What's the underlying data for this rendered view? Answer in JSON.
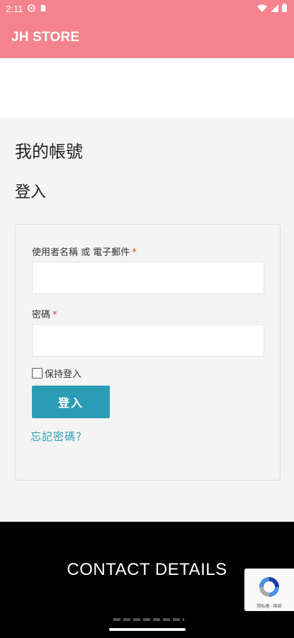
{
  "status_bar": {
    "time": "2:11"
  },
  "app_bar": {
    "title": "JH STORE"
  },
  "account": {
    "page_title": "我的帳號",
    "section_title": "登入"
  },
  "login_form": {
    "username_label": "使用者名稱 或 電子郵件",
    "password_label": "密碼",
    "required_mark": "*",
    "username_value": "",
    "password_value": "",
    "remember_label": "保持登入",
    "remember_checked": false,
    "submit_label": "登入",
    "forgot_link": "忘記密碼？"
  },
  "footer": {
    "contact_title": "CONTACT DETAILS"
  },
  "recaptcha": {
    "text": "隱私權 - 條款"
  },
  "colors": {
    "brand": "#f5838d",
    "button": "#2a9db5",
    "footer": "#000000"
  }
}
